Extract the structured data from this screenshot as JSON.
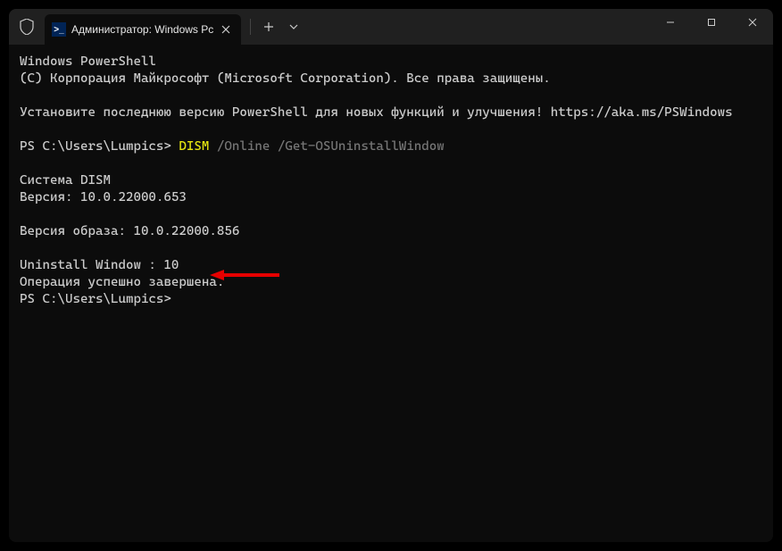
{
  "window": {
    "tab_title": "Администратор: Windows Pc",
    "tab_icon_glyph": ">_"
  },
  "terminal": {
    "line1": "Windows PowerShell",
    "line2": "(C) Корпорация Майкрософт (Microsoft Corporation). Все права защищены.",
    "line3a": "Установите последнюю версию PowerShell для новых функций и улучшения! ",
    "line3b": "https://aka.ms/PSWindows",
    "prompt1": "PS C:\\Users\\Lumpics> ",
    "cmd_yellow": "DISM",
    "cmd_rest": " /Online /Get-OSUninstallWindow",
    "out1": "Cистема DISM",
    "out2": "Версия: 10.0.22000.653",
    "out3": "Версия образа: 10.0.22000.856",
    "out4": "Uninstall Window : 10",
    "out5": "Операция успешно завершена.",
    "prompt2": "PS C:\\Users\\Lumpics>"
  }
}
